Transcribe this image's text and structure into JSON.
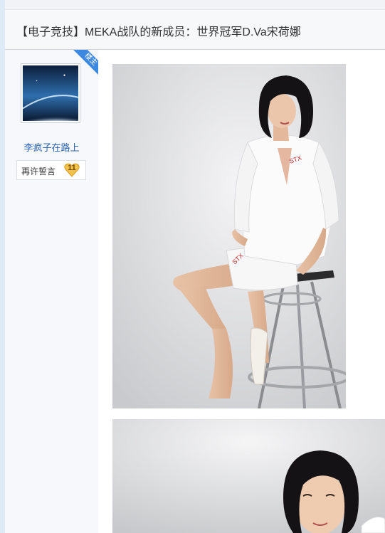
{
  "post": {
    "title": "【电子竞技】MEKA战队的新成员：世界冠军D.Va宋荷娜"
  },
  "author": {
    "badge": "楼主",
    "name": "李疯子在路上",
    "oath_label": "再许誓言",
    "level": "11"
  },
  "colors": {
    "page_background": "#dfeaf6",
    "title_bar": "#f7f8fa",
    "sidebar": "#f7f8fb",
    "link": "#2d64b3",
    "badge": "#3d88e0"
  },
  "images": [
    {
      "name": "post-photo-1"
    },
    {
      "name": "post-photo-2"
    }
  ]
}
